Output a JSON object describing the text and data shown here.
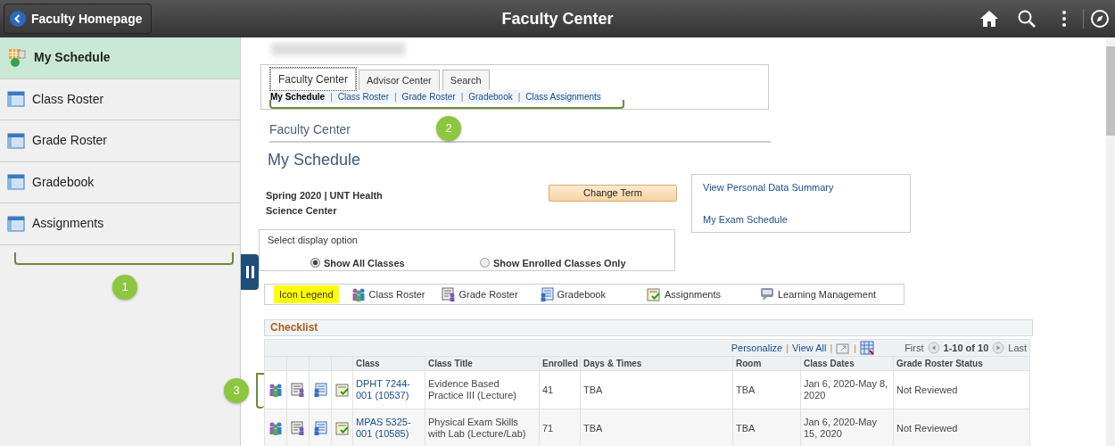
{
  "header": {
    "back_button": "Faculty Homepage",
    "title": "Faculty Center"
  },
  "sidebar": {
    "items": [
      {
        "label": "My Schedule",
        "selected": true,
        "kind": "schedule"
      },
      {
        "label": "Class Roster",
        "selected": false,
        "kind": "page"
      },
      {
        "label": "Grade Roster",
        "selected": false,
        "kind": "page"
      },
      {
        "label": "Gradebook",
        "selected": false,
        "kind": "page"
      },
      {
        "label": "Assignments",
        "selected": false,
        "kind": "page"
      }
    ]
  },
  "tabs": [
    {
      "label": "Faculty Center",
      "selected": true
    },
    {
      "label": "Advisor Center",
      "selected": false
    },
    {
      "label": "Search",
      "selected": false
    }
  ],
  "subnav": {
    "items": [
      {
        "label": "My Schedule",
        "selected": true
      },
      {
        "label": "Class Roster",
        "selected": false
      },
      {
        "label": "Grade Roster",
        "selected": false
      },
      {
        "label": "Gradebook",
        "selected": false
      },
      {
        "label": "Class Assignments",
        "selected": false
      }
    ],
    "separators": [
      "|",
      "|",
      "|",
      "|"
    ]
  },
  "breadcrumb": "Faculty Center",
  "page_title": "My Schedule",
  "term": "Spring 2020 | UNT Health Science Center",
  "change_term": "Change Term",
  "links": [
    "View Personal Data Summary",
    "My Exam Schedule"
  ],
  "display_option": {
    "title": "Select display option",
    "options": [
      {
        "label": "Show All Classes",
        "selected": true
      },
      {
        "label": "Show Enrolled Classes Only",
        "selected": false
      }
    ]
  },
  "legend": {
    "title": "Icon Legend",
    "items": [
      {
        "kind": "class-roster",
        "label": "Class Roster"
      },
      {
        "kind": "grade-roster",
        "label": "Grade Roster"
      },
      {
        "kind": "gradebook",
        "label": "Gradebook"
      },
      {
        "kind": "assignments",
        "label": "Assignments"
      },
      {
        "kind": "learning",
        "label": "Learning Management"
      }
    ]
  },
  "checklist": {
    "title": "Checklist",
    "toolbar": {
      "personalize": "Personalize",
      "view_all": "View All",
      "first": "First",
      "range": "1-10 of 10",
      "last": "Last",
      "separators": [
        "|",
        "|",
        "|"
      ]
    },
    "columns": [
      "Class",
      "Class Title",
      "Enrolled",
      "Days & Times",
      "Room",
      "Class Dates",
      "Grade Roster Status"
    ],
    "rows": [
      {
        "class": "DPHT 7244-001 (10537)",
        "title": "Evidence Based Practice III (Lecture)",
        "enrolled": "41",
        "days": "TBA",
        "room": "TBA",
        "dates": "Jan 6, 2020-May 8, 2020",
        "status": "Not Reviewed"
      },
      {
        "class": "MPAS 5325-001 (10585)",
        "title": "Physical Exam Skills with Lab (Lecture/Lab)",
        "enrolled": "71",
        "days": "TBA",
        "room": "TBA",
        "dates": "Jan 6, 2020-May 15, 2020",
        "status": "Not Reviewed"
      }
    ]
  },
  "callouts": [
    {
      "number": "1"
    },
    {
      "number": "2"
    },
    {
      "number": "3"
    }
  ]
}
